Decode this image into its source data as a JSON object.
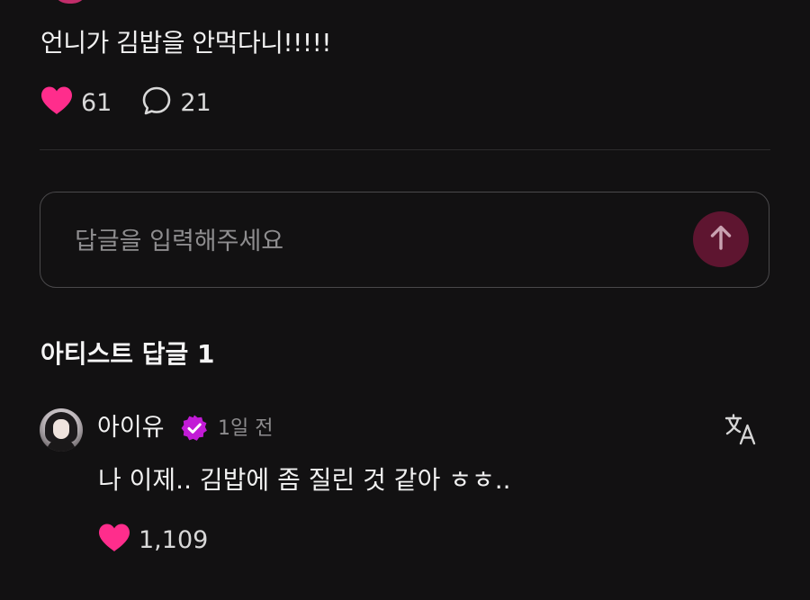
{
  "post": {
    "text": "언니가 김밥을 안먹다니!!!!!",
    "like_count": "61",
    "comment_count": "21"
  },
  "reply_input": {
    "placeholder": "답글을 입력해주세요"
  },
  "artist_section": {
    "title": "아티스트 답글 1"
  },
  "artist_reply": {
    "author": "아이유",
    "time": "1일 전",
    "text": "나 이제.. 김밥에 좀 질린 것 같아 ㅎㅎ..",
    "like_count": "1,109"
  },
  "colors": {
    "background": "#121112",
    "heart": "#ff2d8c",
    "send_button": "#5e1530",
    "verified_badge": "#c21bd6"
  },
  "icons": {
    "like": "heart-icon",
    "comment": "speech-bubble-icon",
    "send": "arrow-up-icon",
    "verified": "verified-badge-icon",
    "translate": "translate-icon"
  }
}
